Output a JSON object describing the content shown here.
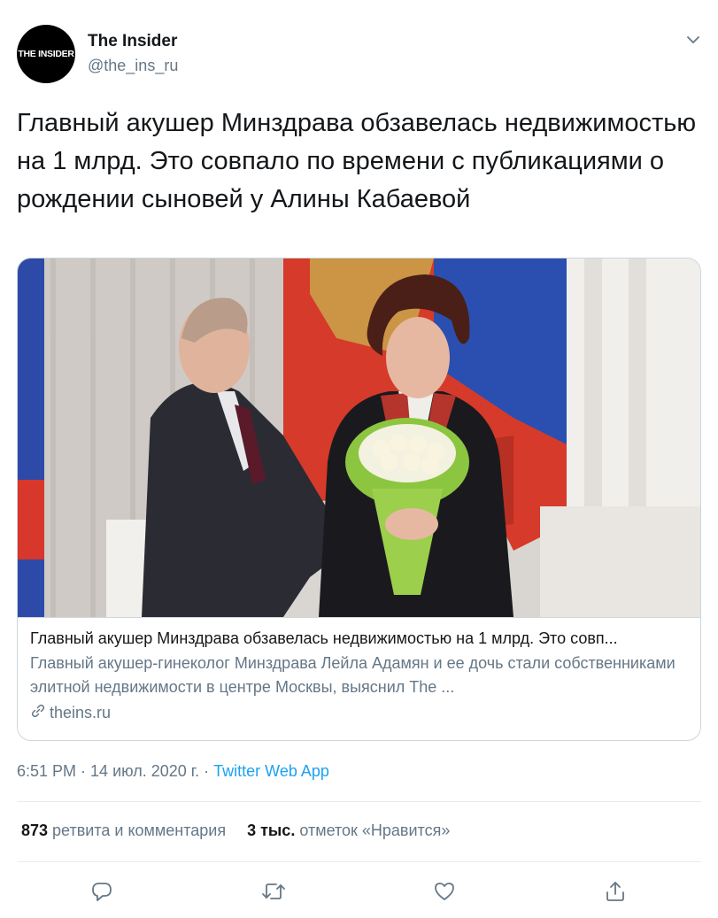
{
  "account": {
    "avatar_text": "THE INSIDER",
    "display_name": "The Insider",
    "handle": "@the_ins_ru"
  },
  "tweet": {
    "text": "Главный акушер Минздрава обзавелась недвижимостью на 1 млрд. Это совпало по времени с публикациями о рождении сыновей у Алины Кабаевой"
  },
  "card": {
    "title": "Главный акушер Минздрава обзавелась недвижимостью на 1 млрд. Это совп...",
    "description": "Главный акушер-гинеколог Минздрава Лейла Адамян и ее дочь стали собственниками элитной недвижимости в центре Москвы, выяснил The ...",
    "domain": "theins.ru"
  },
  "meta": {
    "time": "6:51 PM",
    "sep1": " · ",
    "date": "14 июл. 2020 г.",
    "sep2": " · ",
    "source": "Twitter Web App"
  },
  "stats": {
    "retweets_count": "873",
    "retweets_label": " ретвита и комментария",
    "likes_count": "3 тыс.",
    "likes_label": " отметок «Нравится»"
  },
  "icons": {
    "reply": "reply-icon",
    "retweet": "retweet-icon",
    "like": "heart-icon",
    "share": "share-icon",
    "caret": "chevron-down-icon",
    "link": "link-icon"
  },
  "colors": {
    "accent": "#1da1f2",
    "secondary_text": "#657786",
    "primary_text": "#14171a",
    "border": "#ccd6dd"
  }
}
